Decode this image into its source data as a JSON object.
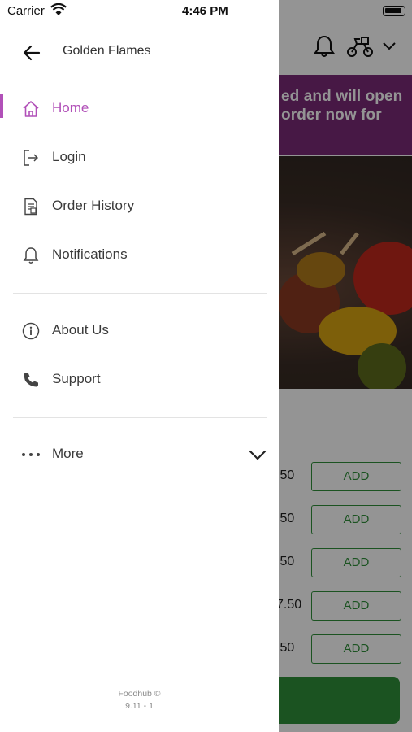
{
  "status_bar": {
    "carrier": "Carrier",
    "time": "4:46 PM",
    "icons": [
      "wifi-icon",
      "battery-icon"
    ]
  },
  "drawer": {
    "store_name": "Golden Flames",
    "menu": [
      {
        "label": "Home",
        "icon": "home-icon",
        "active": true
      },
      {
        "label": "Login",
        "icon": "login-icon",
        "active": false
      },
      {
        "label": "Order History",
        "icon": "receipt-icon",
        "active": false
      },
      {
        "label": "Notifications",
        "icon": "bell-icon",
        "active": false
      }
    ],
    "menu_secondary": [
      {
        "label": "About Us",
        "icon": "info-icon"
      },
      {
        "label": "Support",
        "icon": "phone-icon"
      }
    ],
    "more": {
      "label": "More",
      "icon": "more-dots-icon",
      "expand_icon": "chevron-down-icon"
    },
    "footer": {
      "brand": "Foodhub ©",
      "version": "9.11 - 1"
    }
  },
  "background": {
    "banner_line1": "ed and will open",
    "banner_line2": "order now for",
    "prices": [
      ".50",
      ".50",
      ".50",
      "7.50",
      ".50"
    ],
    "add_label": "ADD",
    "header_icons": [
      "bell-icon",
      "scooter-icon",
      "chevron-down-icon"
    ]
  },
  "colors": {
    "accent": "#b150b8",
    "banner": "#7a2a78",
    "add_green": "#2f8f3a",
    "scrim": "rgba(0,0,0,0.42)"
  }
}
